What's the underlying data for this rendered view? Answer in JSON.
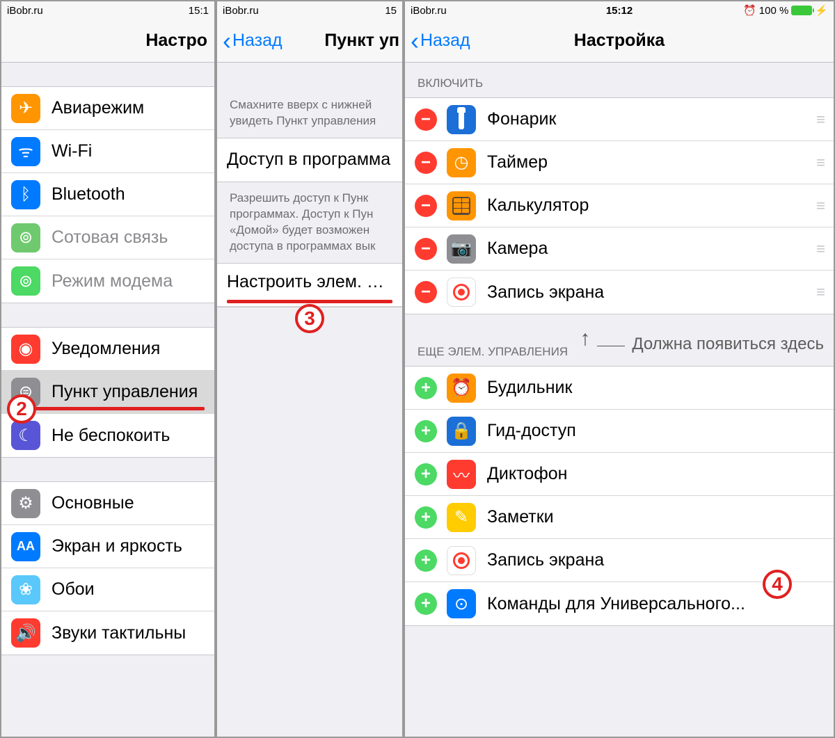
{
  "statusbar": {
    "carrier": "iBobr.ru",
    "time1": "15:1",
    "time2": "15",
    "time3": "15:12",
    "battery": "100 %"
  },
  "panel1": {
    "title": "Настро",
    "rows": [
      {
        "icon": "airplane",
        "color": "i-orange",
        "label": "Авиарежим"
      },
      {
        "icon": "wifi",
        "color": "i-blue",
        "label": "Wi-Fi"
      },
      {
        "icon": "bluetooth",
        "color": "i-blue",
        "label": "Bluetooth"
      },
      {
        "icon": "cellular",
        "color": "i-green",
        "label": "Сотовая связь",
        "dim": true
      },
      {
        "icon": "hotspot",
        "color": "i-teal",
        "label": "Режим модема",
        "dim": true
      }
    ],
    "rows2": [
      {
        "icon": "notif",
        "color": "i-red",
        "label": "Уведомления"
      },
      {
        "icon": "control",
        "color": "i-gray",
        "label": "Пункт управления",
        "selected": true,
        "underline": true
      },
      {
        "icon": "dnd",
        "color": "i-purple",
        "label": "Не беспокоить"
      }
    ],
    "rows3": [
      {
        "icon": "general",
        "color": "i-gray",
        "label": "Основные"
      },
      {
        "icon": "display",
        "color": "i-blue",
        "label": "Экран и яркость"
      },
      {
        "icon": "wallpaper",
        "color": "i-bluegr",
        "label": "Обои"
      },
      {
        "icon": "sound",
        "color": "i-red",
        "label": "Звуки  тактильны"
      }
    ],
    "badge2": "2"
  },
  "panel2": {
    "back": "Назад",
    "title": "Пункт уп",
    "footer1": "Смахните вверх с нижней увидеть Пункт управления",
    "toggle_label": "Доступ в программа",
    "footer2": "Разрешить доступ к Пунк программах. Доступ к Пун «Домой» будет возможен доступа в программах вык",
    "customize": "Настроить элем. упр",
    "badge3": "3"
  },
  "panel3": {
    "back": "Назад",
    "title": "Настройка",
    "section_include": "ВКЛЮЧИТЬ",
    "include": [
      {
        "icon": "flashlight",
        "color": "i-darkblue",
        "label": "Фонарик"
      },
      {
        "icon": "timer",
        "color": "i-orange",
        "label": "Таймер"
      },
      {
        "icon": "calc",
        "color": "i-calc",
        "label": "Калькулятор"
      },
      {
        "icon": "camera",
        "color": "i-gray",
        "label": "Камера"
      },
      {
        "icon": "record",
        "color": "i-rec",
        "label": "Запись экрана"
      }
    ],
    "annotation": "Должна появиться здесь",
    "section_more": "ЕЩЕ ЭЛЕМ. УПРАВЛЕНИЯ",
    "more": [
      {
        "icon": "alarm",
        "color": "i-orange",
        "label": "Будильник"
      },
      {
        "icon": "guided",
        "color": "i-darkblue",
        "label": "Гид-доступ"
      },
      {
        "icon": "voice",
        "color": "i-red",
        "label": "Диктофон"
      },
      {
        "icon": "notes",
        "color": "i-yellow",
        "label": "Заметки"
      },
      {
        "icon": "record",
        "color": "i-rec",
        "label": "Запись экрана",
        "underline": true
      },
      {
        "icon": "access",
        "color": "i-blue",
        "label": "Команды для Универсального..."
      }
    ],
    "badge4": "4"
  },
  "glyph": {
    "airplane": "✈",
    "wifi": "ᯤ",
    "bluetooth": "ᛒ",
    "cellular": "⊚",
    "hotspot": "⊚",
    "notif": "◉",
    "control": "⊜",
    "dnd": "☾",
    "general": "⚙",
    "display": "AA",
    "wallpaper": "❀",
    "sound": "🔊",
    "flashlight": "",
    "timer": "◷",
    "calc": "",
    "camera": "📷",
    "record": "",
    "alarm": "⏰",
    "guided": "🔒",
    "voice": "〰",
    "notes": "✎",
    "access": "⊙"
  }
}
